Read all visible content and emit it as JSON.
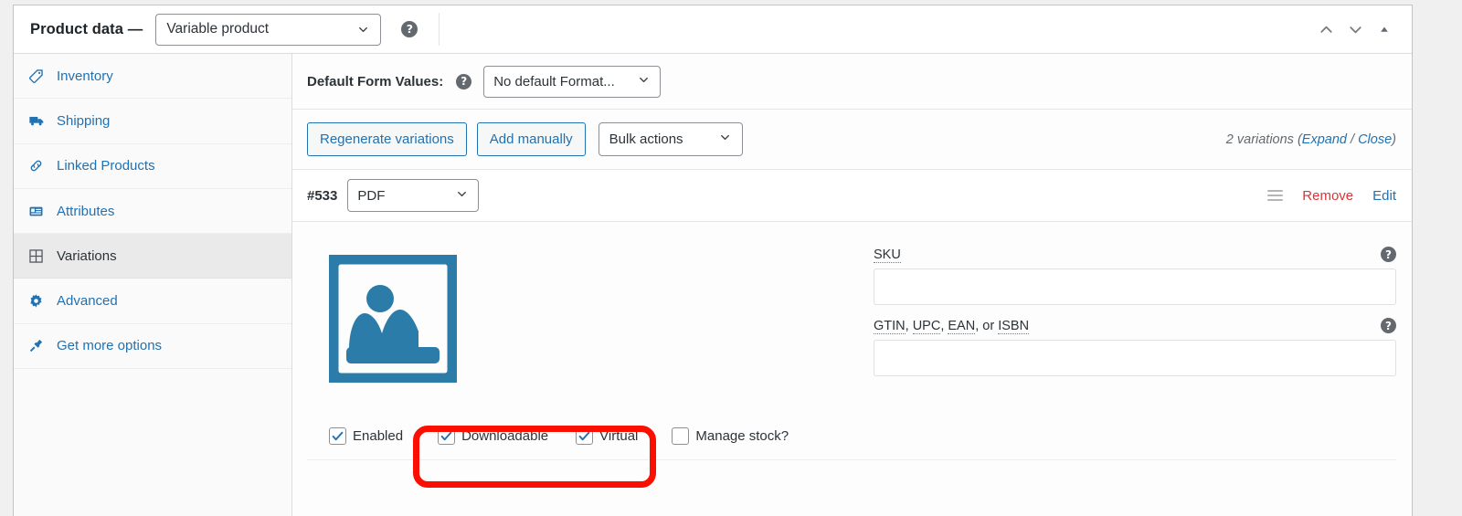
{
  "header": {
    "title": "Product data —",
    "product_type": "Variable product",
    "help_icon": "help-icon",
    "controls": {
      "move_up": "chevron-up-icon",
      "move_down": "chevron-down-icon",
      "toggle_panel": "triangle-up-icon"
    }
  },
  "sidebar": {
    "items": [
      {
        "label": "Inventory",
        "icon": "inventory-icon",
        "active": false
      },
      {
        "label": "Shipping",
        "icon": "truck-icon",
        "active": false
      },
      {
        "label": "Linked Products",
        "icon": "link-icon",
        "active": false
      },
      {
        "label": "Attributes",
        "icon": "list-icon",
        "active": false
      },
      {
        "label": "Variations",
        "icon": "grid-icon",
        "active": true
      },
      {
        "label": "Advanced",
        "icon": "gear-icon",
        "active": false
      },
      {
        "label": "Get more options",
        "icon": "plug-icon",
        "active": false
      }
    ]
  },
  "defaults": {
    "label": "Default Form Values:",
    "help_icon": "help-icon",
    "selected": "No default Format...",
    "chevron": "chevron-down-icon"
  },
  "toolbar": {
    "regenerate_label": "Regenerate variations",
    "add_manually_label": "Add manually",
    "bulk_actions_label": "Bulk actions",
    "bulk_chevron": "chevron-down-icon",
    "count_prefix": "2 variations (",
    "expand_label": "Expand",
    "count_separator": " / ",
    "close_label": "Close",
    "count_suffix": ")"
  },
  "variation": {
    "id": "#533",
    "attribute_value": "PDF",
    "attribute_chevron": "chevron-down-icon",
    "sort_handle": "drag-handle-icon",
    "remove_label": "Remove",
    "edit_label": "Edit",
    "image_alt": "image-placeholder-icon",
    "fields": [
      {
        "label_parts": [
          {
            "text": "SKU",
            "abbr": true
          }
        ],
        "value": "",
        "placeholder": "",
        "help_icon": "help-icon",
        "name": "sku"
      },
      {
        "label_parts": [
          {
            "text": "GTIN",
            "abbr": true
          },
          {
            "text": ", ",
            "abbr": false
          },
          {
            "text": "UPC",
            "abbr": true
          },
          {
            "text": ", ",
            "abbr": false
          },
          {
            "text": "EAN",
            "abbr": true
          },
          {
            "text": ", or ",
            "abbr": false
          },
          {
            "text": "ISBN",
            "abbr": true
          }
        ],
        "value": "",
        "placeholder": "",
        "help_icon": "help-icon",
        "name": "gtin"
      }
    ],
    "checkboxes": [
      {
        "label": "Enabled",
        "checked": true,
        "name": "enabled"
      },
      {
        "label": "Downloadable",
        "checked": true,
        "name": "downloadable"
      },
      {
        "label": "Virtual",
        "checked": true,
        "name": "virtual"
      },
      {
        "label": "Manage stock?",
        "checked": false,
        "name": "manage-stock"
      }
    ]
  },
  "annotation": {
    "type": "red-highlight-rectangle",
    "color": "#fa0f00",
    "targets": "Downloadable, Virtual"
  },
  "colors": {
    "link": "#2271b1",
    "danger": "#d63638",
    "text": "#2c3338",
    "muted": "#646970",
    "image_placeholder": "#2b7ca8",
    "checkbox_check": "#2271b1",
    "annotation": "#fa0f00",
    "panel_border": "#c3c4c7",
    "active_row": "#eaeaea"
  }
}
